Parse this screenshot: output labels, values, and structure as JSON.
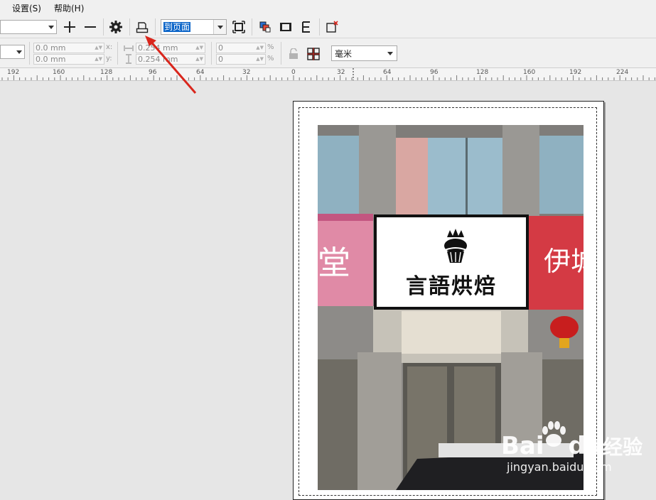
{
  "menu": {
    "items": [
      "设置(S)",
      "帮助(H)"
    ]
  },
  "toolbar": {
    "zoom_value": "到页面",
    "icons": [
      "plus-icon",
      "minus-icon",
      "gear-icon",
      "print-icon",
      "fullscreen-icon",
      "layers-icon",
      "film-icon",
      "text-e-icon",
      "close-page-icon"
    ]
  },
  "properties": {
    "x1": "0.0 mm",
    "y1": "0.0 mm",
    "x_label": "x:",
    "y_label": "y:",
    "w": "0.254 mm",
    "h": "0.254 mm",
    "p1": "0",
    "p2": "0",
    "pct": "%",
    "units": "毫米"
  },
  "ruler": {
    "labels": [
      "192",
      "160",
      "128",
      "96",
      "64",
      "32",
      "0",
      "32",
      "64",
      "96",
      "128",
      "160",
      "192",
      "224"
    ]
  },
  "sign": {
    "text": "言語烘焙"
  },
  "watermark": {
    "brand": "Bai",
    "brand2": "du",
    "suffix": "经验",
    "url": "jingyan.baidu.com"
  },
  "colors": {
    "accent_red": "#d9261c",
    "selection": "#0a64c8"
  }
}
